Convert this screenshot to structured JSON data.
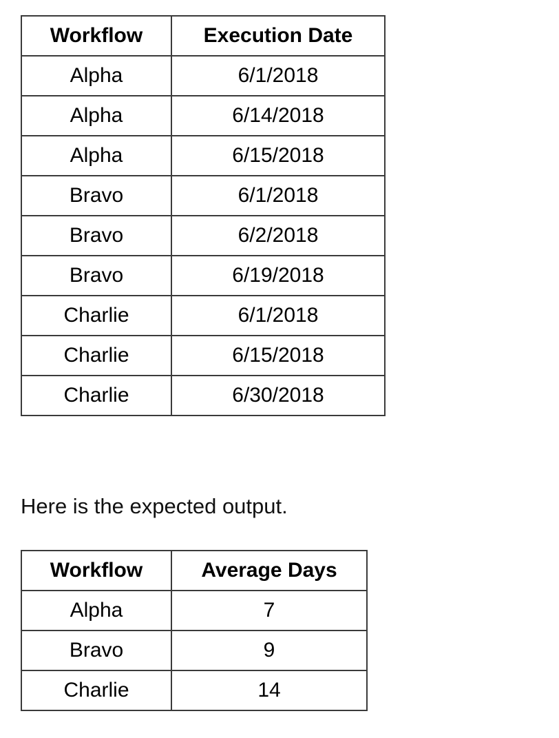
{
  "document": {
    "caption": "Here is the expected output."
  },
  "input_table": {
    "name": "workflow-execution-dates",
    "columns": [
      "Workflow",
      "Execution Date"
    ],
    "rows": [
      [
        "Alpha",
        "6/1/2018"
      ],
      [
        "Alpha",
        "6/14/2018"
      ],
      [
        "Alpha",
        "6/15/2018"
      ],
      [
        "Bravo",
        "6/1/2018"
      ],
      [
        "Bravo",
        "6/2/2018"
      ],
      [
        "Bravo",
        "6/19/2018"
      ],
      [
        "Charlie",
        "6/1/2018"
      ],
      [
        "Charlie",
        "6/15/2018"
      ],
      [
        "Charlie",
        "6/30/2018"
      ]
    ]
  },
  "output_table": {
    "name": "workflow-average-days",
    "columns": [
      "Workflow",
      "Average Days"
    ],
    "rows": [
      [
        "Alpha",
        "7"
      ],
      [
        "Bravo",
        "9"
      ],
      [
        "Charlie",
        "14"
      ]
    ]
  },
  "colors": {
    "border": "#3a3a3a",
    "text": "#000000",
    "background": "#ffffff"
  }
}
